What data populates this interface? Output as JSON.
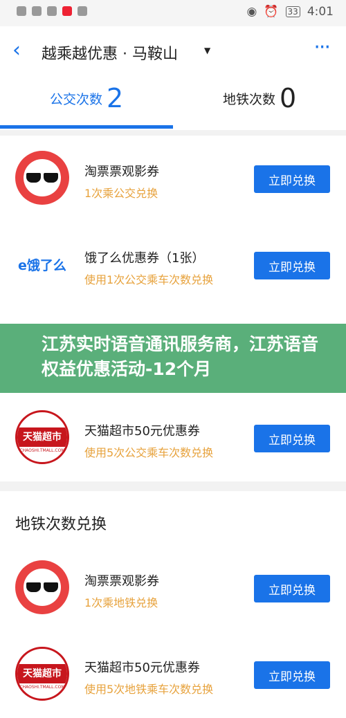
{
  "status_bar": {
    "time": "4:01",
    "battery": "33"
  },
  "header": {
    "back_label": "<",
    "title": "越乘越优惠 · 马鞍山",
    "more_label": "•••",
    "tabs": [
      {
        "label": "公交次数",
        "count": "2"
      },
      {
        "label": "地铁次数",
        "count": "0"
      }
    ]
  },
  "bus_items": [
    {
      "logo": "taopiao",
      "name": "淘票票观影券",
      "sub": "1次乘公交兑换",
      "button": "立即兑换"
    },
    {
      "logo": "eleme",
      "logo_text": "e饿了么",
      "name": "饿了么优惠券（1张）",
      "sub": "使用1次公交乘车次数兑换",
      "button": "立即兑换"
    },
    {
      "logo": "tmall",
      "logo_text": "天猫超市",
      "logo_sub": "CHAOSHI.TMALL.COM",
      "name": "天猫超市50元优惠券",
      "sub": "使用5次公交乘车次数兑换",
      "button": "立即兑换"
    }
  ],
  "overlay": {
    "text": "江苏实时语音通讯服务商，江苏语音权益优惠活动-12个月"
  },
  "metro_section": {
    "title": "地铁次数兑换",
    "items": [
      {
        "logo": "taopiao",
        "name": "淘票票观影券",
        "sub": "1次乘地铁兑换",
        "button": "立即兑换"
      },
      {
        "logo": "tmall",
        "logo_text": "天猫超市",
        "logo_sub": "CHAOSHI.TMALL.COM",
        "name": "天猫超市50元优惠券",
        "sub": "使用5次地铁乘车次数兑换",
        "button": "立即兑换"
      }
    ]
  },
  "colors": {
    "accent": "#1a73e8",
    "orange": "#e7a23c",
    "overlay": "#4ca86f"
  }
}
